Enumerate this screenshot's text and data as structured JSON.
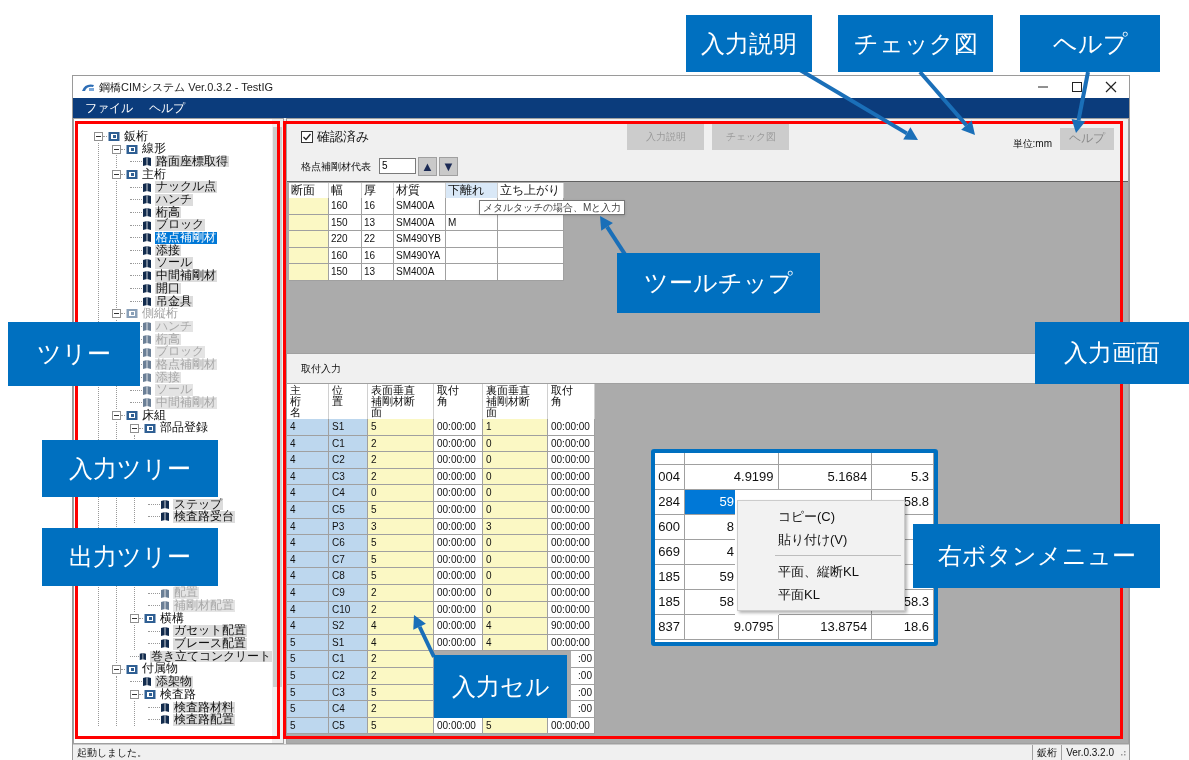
{
  "window": {
    "title": "鋼橋CIMシステム Ver.0.3.2 - TestIG"
  },
  "menu": [
    "ファイル",
    "ヘルプ"
  ],
  "tree": [
    {
      "kind": "folder",
      "label": "鈑桁",
      "expanded": true,
      "disabled": false,
      "children": [
        {
          "kind": "folder",
          "label": "線形",
          "expanded": true,
          "disabled": false,
          "children": [
            {
              "kind": "leaf",
              "label": "路面座標取得",
              "selected": false,
              "disabled": false
            }
          ]
        },
        {
          "kind": "folder",
          "label": "主桁",
          "expanded": true,
          "disabled": false,
          "children": [
            {
              "kind": "leaf",
              "label": "ナックル点",
              "selected": false,
              "disabled": false
            },
            {
              "kind": "leaf",
              "label": "ハンチ",
              "selected": false,
              "disabled": false
            },
            {
              "kind": "leaf",
              "label": "桁高",
              "selected": false,
              "disabled": false
            },
            {
              "kind": "leaf",
              "label": "ブロック",
              "selected": false,
              "disabled": false
            },
            {
              "kind": "leaf",
              "label": "格点補剛材",
              "selected": true,
              "disabled": false
            },
            {
              "kind": "leaf",
              "label": "添接",
              "selected": false,
              "disabled": false
            },
            {
              "kind": "leaf",
              "label": "ソール",
              "selected": false,
              "disabled": false
            },
            {
              "kind": "leaf",
              "label": "中間補剛材",
              "selected": false,
              "disabled": false
            },
            {
              "kind": "leaf",
              "label": "開口",
              "selected": false,
              "disabled": false
            },
            {
              "kind": "leaf",
              "label": "吊金具",
              "selected": false,
              "disabled": false
            }
          ]
        },
        {
          "kind": "folder",
          "label": "側縦桁",
          "expanded": true,
          "disabled": true,
          "children": [
            {
              "kind": "leaf",
              "label": "ハンチ",
              "selected": false,
              "disabled": true
            },
            {
              "kind": "leaf",
              "label": "桁高",
              "selected": false,
              "disabled": true
            },
            {
              "kind": "leaf",
              "label": "ブロック",
              "selected": false,
              "disabled": true
            },
            {
              "kind": "leaf",
              "label": "格点補剛材",
              "selected": false,
              "disabled": true
            },
            {
              "kind": "leaf",
              "label": "添接",
              "selected": false,
              "disabled": true
            },
            {
              "kind": "leaf",
              "label": "ソール",
              "selected": false,
              "disabled": true
            },
            {
              "kind": "leaf",
              "label": "中間補剛材",
              "selected": false,
              "disabled": true
            }
          ]
        },
        {
          "kind": "folder",
          "label": "床組",
          "expanded": true,
          "disabled": false,
          "children": [
            {
              "kind": "folder",
              "label": "部品登録",
              "expanded": true,
              "disabled": false,
              "children": [
                {
                  "kind": "covered"
                },
                {
                  "kind": "covered"
                },
                {
                  "kind": "covered"
                },
                {
                  "kind": "covered"
                },
                {
                  "kind": "covered"
                },
                {
                  "kind": "leaf",
                  "label": "ステップ",
                  "selected": false,
                  "disabled": false
                },
                {
                  "kind": "leaf",
                  "label": "検査路受台",
                  "selected": false,
                  "disabled": false
                }
              ]
            },
            {
              "kind": "covered"
            },
            {
              "kind": "covered"
            },
            {
              "kind": "covered"
            },
            {
              "kind": "covered"
            },
            {
              "kind": "covered",
              "children": [
                {
                  "kind": "leaf",
                  "label": "配置",
                  "selected": false,
                  "disabled": true
                },
                {
                  "kind": "leaf",
                  "label": "補剛材配置",
                  "selected": false,
                  "disabled": true
                }
              ]
            },
            {
              "kind": "folder",
              "label": "横構",
              "expanded": true,
              "disabled": false,
              "children": [
                {
                  "kind": "leaf",
                  "label": "ガセット配置",
                  "selected": false,
                  "disabled": false
                },
                {
                  "kind": "leaf",
                  "label": "ブレース配置",
                  "selected": false,
                  "disabled": false
                }
              ]
            },
            {
              "kind": "leaf",
              "label": "巻き立てコンクリート",
              "selected": false,
              "disabled": false
            }
          ]
        },
        {
          "kind": "folder",
          "label": "付属物",
          "expanded": true,
          "disabled": false,
          "children": [
            {
              "kind": "leaf",
              "label": "添架物",
              "selected": false,
              "disabled": false
            },
            {
              "kind": "folder",
              "label": "検査路",
              "expanded": true,
              "disabled": false,
              "children": [
                {
                  "kind": "leaf",
                  "label": "検査路材料",
                  "selected": false,
                  "disabled": false
                },
                {
                  "kind": "leaf",
                  "label": "検査路配置",
                  "selected": false,
                  "disabled": false
                }
              ]
            }
          ]
        }
      ]
    }
  ],
  "form": {
    "confirmed": {
      "label": "確認済み",
      "checked": true
    },
    "buttons": [
      {
        "label": "入力説明",
        "disabled": true
      },
      {
        "label": "チェック図",
        "disabled": true
      }
    ],
    "unit": "単位:mm",
    "help_button": {
      "label": "ヘルプ",
      "disabled": true
    },
    "representative": {
      "label": "格点補剛材代表",
      "value": "5",
      "buttons": [
        "▲",
        "▼"
      ]
    }
  },
  "upper_table": {
    "columns": [
      {
        "label": "断面",
        "kind": "input",
        "selected": false
      },
      {
        "label": "幅",
        "kind": "plain",
        "selected": false
      },
      {
        "label": "厚",
        "kind": "plain",
        "selected": false
      },
      {
        "label": "材質",
        "kind": "plain",
        "selected": false
      },
      {
        "label": "下離れ",
        "kind": "plain",
        "selected": true
      },
      {
        "label": "立ち上がり",
        "kind": "plain",
        "selected": false
      }
    ],
    "rows": [
      [
        "",
        "160",
        "16",
        "SM400A",
        "",
        ""
      ],
      [
        "",
        "150",
        "13",
        "SM400A",
        "M",
        ""
      ],
      [
        "",
        "220",
        "22",
        "SM490YB",
        "",
        ""
      ],
      [
        "",
        "160",
        "16",
        "SM490YA",
        "",
        ""
      ],
      [
        "",
        "150",
        "13",
        "SM400A",
        "",
        ""
      ]
    ]
  },
  "tooltip": "メタルタッチの場合、Mと入力",
  "section_label": "取付入力",
  "lower_table": {
    "columns": [
      {
        "label": "主桁名",
        "kind": "key"
      },
      {
        "label": "位置",
        "kind": "key"
      },
      {
        "label": "表面垂直補剛材断面",
        "kind": "input"
      },
      {
        "label": "取付角",
        "kind": "plain"
      },
      {
        "label": "裏面垂直補剛材断面",
        "kind": "input"
      },
      {
        "label": "取付角",
        "kind": "plain"
      }
    ],
    "rows": [
      [
        "4",
        "S1",
        "5",
        "00:00:00",
        "1",
        "00:00:00"
      ],
      [
        "4",
        "C1",
        "2",
        "00:00:00",
        "0",
        "00:00:00"
      ],
      [
        "4",
        "C2",
        "2",
        "00:00:00",
        "0",
        "00:00:00"
      ],
      [
        "4",
        "C3",
        "2",
        "00:00:00",
        "0",
        "00:00:00"
      ],
      [
        "4",
        "C4",
        "0",
        "00:00:00",
        "0",
        "00:00:00"
      ],
      [
        "4",
        "C5",
        "5",
        "00:00:00",
        "0",
        "00:00:00"
      ],
      [
        "4",
        "P3",
        "3",
        "00:00:00",
        "3",
        "00:00:00"
      ],
      [
        "4",
        "C6",
        "5",
        "00:00:00",
        "0",
        "00:00:00"
      ],
      [
        "4",
        "C7",
        "5",
        "00:00:00",
        "0",
        "00:00:00"
      ],
      [
        "4",
        "C8",
        "5",
        "00:00:00",
        "0",
        "00:00:00"
      ],
      [
        "4",
        "C9",
        "2",
        "00:00:00",
        "0",
        "00:00:00"
      ],
      [
        "4",
        "C10",
        "2",
        "00:00:00",
        "0",
        "00:00:00"
      ],
      [
        "4",
        "S2",
        "4",
        "00:00:00",
        "4",
        "90:00:00"
      ],
      [
        "5",
        "S1",
        "4",
        "00:00:00",
        "4",
        "00:00:00"
      ],
      [
        "5",
        "C1",
        "2",
        null,
        null,
        {
          "text": ":00",
          "cut": true
        }
      ],
      [
        "5",
        "C2",
        "2",
        null,
        null,
        {
          "text": ":00",
          "cut": true
        }
      ],
      [
        "5",
        "C3",
        "5",
        null,
        null,
        {
          "text": ":00",
          "cut": true
        }
      ],
      [
        "5",
        "C4",
        "2",
        null,
        null,
        {
          "text": ":00",
          "cut": true
        }
      ],
      [
        "5",
        "C5",
        "5",
        "00:00:00",
        "5",
        "00:00:00"
      ]
    ]
  },
  "inset": {
    "rows": [
      [
        "004",
        "4.9199",
        "5.1684",
        "5.3"
      ],
      [
        "284",
        {
          "text": "59",
          "cut": true,
          "selected": true
        },
        "",
        "58.8"
      ],
      [
        "600",
        {
          "text": "8",
          "cut": true
        },
        "",
        ""
      ],
      [
        "669",
        {
          "text": "4",
          "cut": true
        },
        "",
        ""
      ],
      [
        "185",
        {
          "text": "59",
          "cut": true
        },
        "",
        ""
      ],
      [
        "185",
        {
          "text": "58",
          "cut": true
        },
        "",
        "58.3"
      ],
      [
        "837",
        "9.0795",
        "13.8754",
        "18.6"
      ]
    ]
  },
  "context_menu": [
    {
      "kind": "item",
      "label": "コピー(C)"
    },
    {
      "kind": "item",
      "label": "貼り付け(V)"
    },
    {
      "kind": "separator"
    },
    {
      "kind": "item",
      "label": "平面、縦断KL"
    },
    {
      "kind": "item",
      "label": "平面KL"
    }
  ],
  "status_bar": {
    "message": "起動しました。",
    "fields": [
      "鈑桁",
      "Ver.0.3.2.0"
    ]
  },
  "callouts": [
    {
      "label": "入力説明"
    },
    {
      "label": "チェック図"
    },
    {
      "label": "ヘルプ"
    },
    {
      "label": "ツールチップ"
    },
    {
      "label": "入力画面"
    },
    {
      "label": "ツリー"
    },
    {
      "label": "入力ツリー"
    },
    {
      "label": "出力ツリー"
    },
    {
      "label": "右ボタンメニュー"
    },
    {
      "label": "入力セル"
    }
  ]
}
